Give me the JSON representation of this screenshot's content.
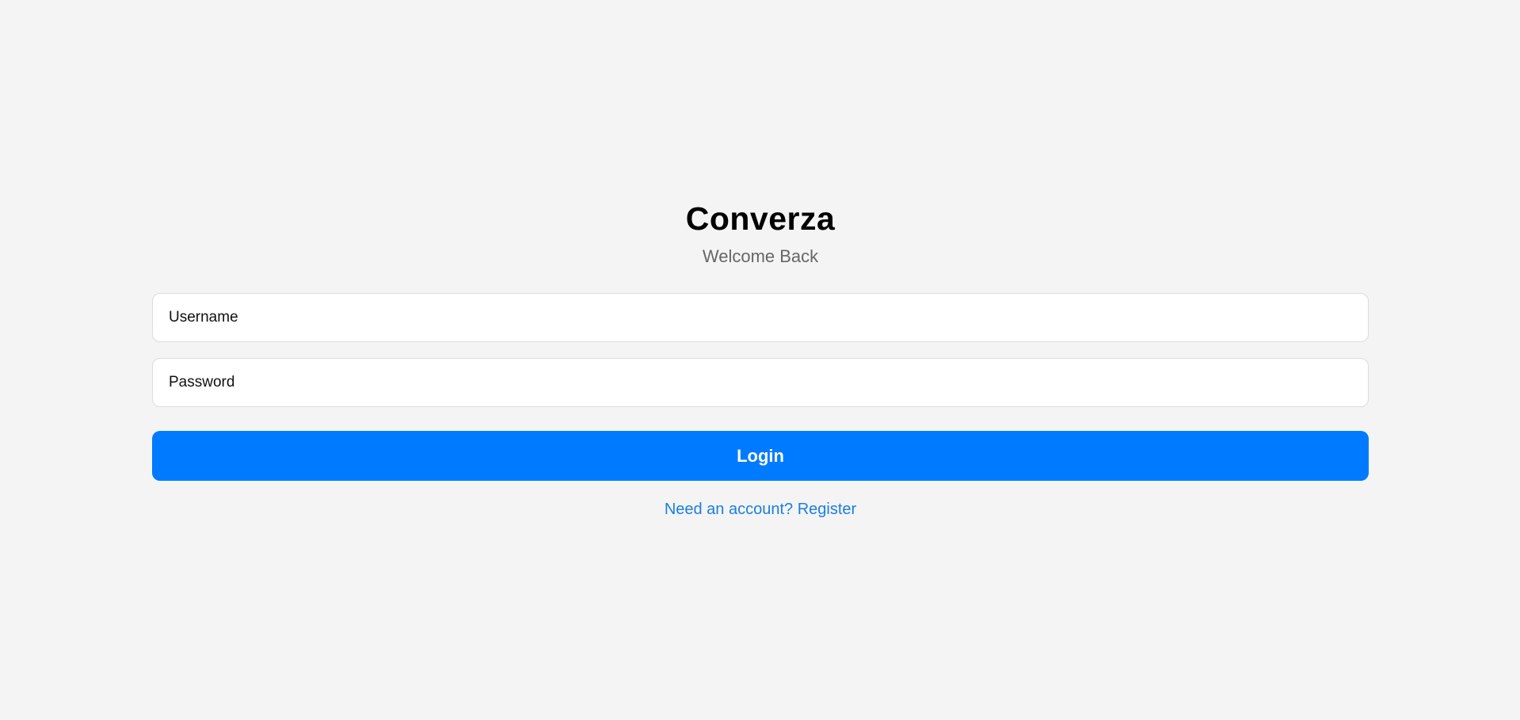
{
  "app": {
    "title": "Converza",
    "subtitle": "Welcome Back"
  },
  "form": {
    "username": {
      "placeholder": "Username",
      "value": ""
    },
    "password": {
      "placeholder": "Password",
      "value": ""
    },
    "login_label": "Login",
    "register_link": "Need an account? Register"
  },
  "colors": {
    "background": "#f4f4f4",
    "accent": "#007bff",
    "link": "#1a7fe0",
    "subtitle": "#666666"
  }
}
